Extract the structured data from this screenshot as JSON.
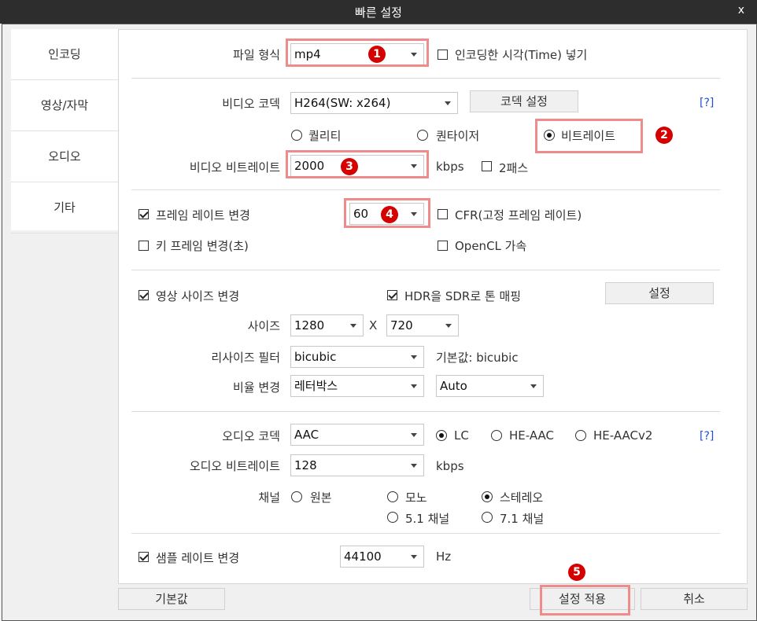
{
  "title": "빠른 설정",
  "close": "x",
  "sidebar": {
    "items": [
      "인코딩",
      "영상/자막",
      "오디오",
      "기타"
    ]
  },
  "file": {
    "label": "파일 형식",
    "value": "mp4",
    "time_check": "인코딩한 시각(Time) 넣기"
  },
  "video": {
    "codec_label": "비디오 코덱",
    "codec_value": "H264(SW: x264)",
    "codec_button": "코덱 설정",
    "help": "[?]",
    "modes": [
      "퀄리티",
      "퀀타이저",
      "비트레이트"
    ],
    "bitrate_label": "비디오 비트레이트",
    "bitrate_value": "2000",
    "kbps": "kbps",
    "twopass": "2패스"
  },
  "framerate": {
    "change_label": "프레임 레이트 변경",
    "value": "60",
    "cfr": "CFR(고정 프레임 레이트)",
    "keyframe": "키 프레임 변경(초)",
    "opencl": "OpenCL 가속"
  },
  "size": {
    "change_label": "영상 사이즈 변경",
    "hdr": "HDR을 SDR로 톤 매핑",
    "hdr_button": "설정",
    "size_label": "사이즈",
    "width": "1280",
    "x": "X",
    "height": "720",
    "filter_label": "리사이즈 필터",
    "filter_value": "bicubic",
    "filter_default": "기본값: bicubic",
    "ratio_label": "비율 변경",
    "ratio_value": "레터박스",
    "ratio_mode": "Auto"
  },
  "audio": {
    "codec_label": "오디오 코덱",
    "codec_value": "AAC",
    "profiles": [
      "LC",
      "HE-AAC",
      "HE-AACv2"
    ],
    "help": "[?]",
    "bitrate_label": "오디오 비트레이트",
    "bitrate_value": "128",
    "kbps": "kbps",
    "channel_label": "채널",
    "channels": [
      "원본",
      "모노",
      "스테레오",
      "5.1 채널",
      "7.1 채널"
    ],
    "sample_label": "샘플 레이트 변경",
    "sample_value": "44100",
    "hz": "Hz"
  },
  "footer": {
    "default": "기본값",
    "apply": "설정 적용",
    "cancel": "취소"
  },
  "badges": [
    "1",
    "2",
    "3",
    "4",
    "5"
  ],
  "colors": {
    "highlight": "#f08b8b",
    "badge": "#d50000",
    "help_link": "#1f4fd6"
  }
}
